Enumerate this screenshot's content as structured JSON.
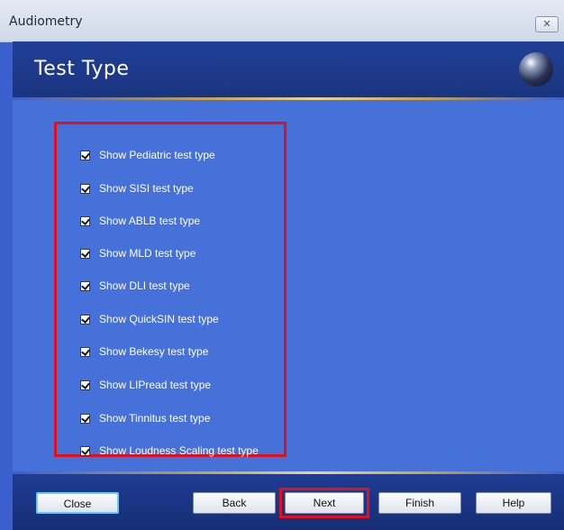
{
  "window": {
    "title": "Audiometry",
    "close_glyph": "✕"
  },
  "header": {
    "title": "Test Type",
    "orb_icon": "globe-orb-icon"
  },
  "options": [
    {
      "label": "Show Pediatric test type",
      "checked": true
    },
    {
      "label": "Show SISI test type",
      "checked": true
    },
    {
      "label": "Show ABLB test type",
      "checked": true
    },
    {
      "label": "Show MLD test type",
      "checked": true
    },
    {
      "label": "Show DLI test type",
      "checked": true
    },
    {
      "label": "Show QuickSIN test type",
      "checked": true
    },
    {
      "label": "Show Bekesy test type",
      "checked": true
    },
    {
      "label": "Show LIPread test type",
      "checked": true
    },
    {
      "label": "Show Tinnitus test type",
      "checked": true
    },
    {
      "label": "Show Loudness Scaling test type",
      "checked": true
    }
  ],
  "footer": {
    "close_label": "Close",
    "back_label": "Back",
    "next_label": "Next",
    "finish_label": "Finish",
    "help_label": "Help"
  },
  "colors": {
    "content_bg": "#4671d9",
    "header_bg": "#203f96",
    "highlight": "#e0101e"
  }
}
